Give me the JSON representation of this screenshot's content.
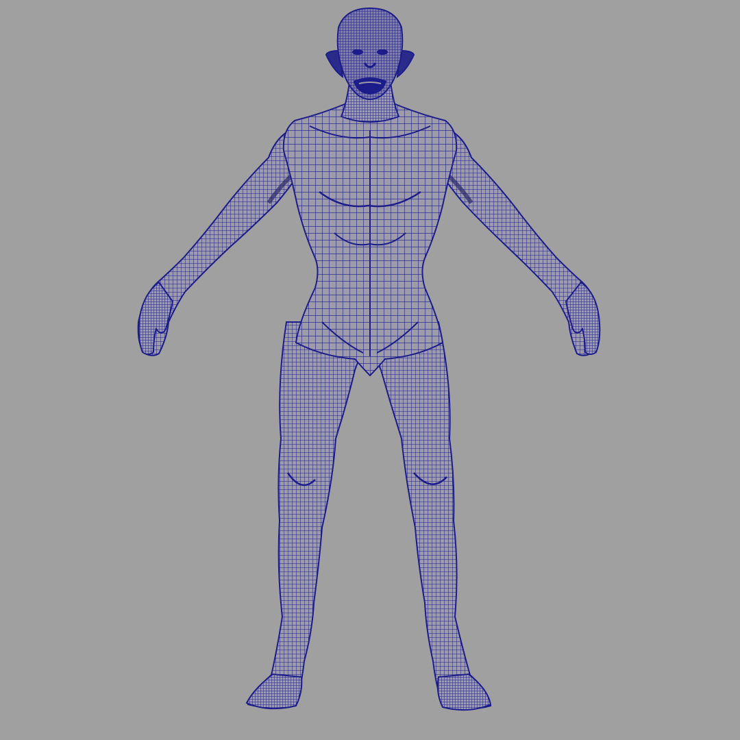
{
  "viewport": {
    "background_color": "#a0a0a0",
    "mesh_wire_color": "#1c1c8a",
    "mesh_fill_color": "#9d9ba8",
    "mesh_shadow_color": "#2a2a6a",
    "subject": "humanoid-creature-mesh-front-view",
    "display_mode": "wireframe-on-shaded"
  }
}
